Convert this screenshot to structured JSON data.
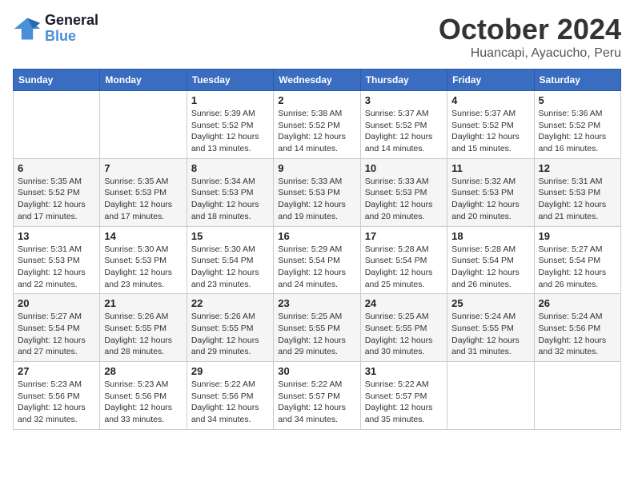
{
  "header": {
    "logo_line1": "General",
    "logo_line2": "Blue",
    "month_title": "October 2024",
    "location": "Huancapi, Ayacucho, Peru"
  },
  "days_of_week": [
    "Sunday",
    "Monday",
    "Tuesday",
    "Wednesday",
    "Thursday",
    "Friday",
    "Saturday"
  ],
  "weeks": [
    [
      {
        "num": "",
        "detail": ""
      },
      {
        "num": "",
        "detail": ""
      },
      {
        "num": "1",
        "detail": "Sunrise: 5:39 AM\nSunset: 5:52 PM\nDaylight: 12 hours and 13 minutes."
      },
      {
        "num": "2",
        "detail": "Sunrise: 5:38 AM\nSunset: 5:52 PM\nDaylight: 12 hours and 14 minutes."
      },
      {
        "num": "3",
        "detail": "Sunrise: 5:37 AM\nSunset: 5:52 PM\nDaylight: 12 hours and 14 minutes."
      },
      {
        "num": "4",
        "detail": "Sunrise: 5:37 AM\nSunset: 5:52 PM\nDaylight: 12 hours and 15 minutes."
      },
      {
        "num": "5",
        "detail": "Sunrise: 5:36 AM\nSunset: 5:52 PM\nDaylight: 12 hours and 16 minutes."
      }
    ],
    [
      {
        "num": "6",
        "detail": "Sunrise: 5:35 AM\nSunset: 5:52 PM\nDaylight: 12 hours and 17 minutes."
      },
      {
        "num": "7",
        "detail": "Sunrise: 5:35 AM\nSunset: 5:53 PM\nDaylight: 12 hours and 17 minutes."
      },
      {
        "num": "8",
        "detail": "Sunrise: 5:34 AM\nSunset: 5:53 PM\nDaylight: 12 hours and 18 minutes."
      },
      {
        "num": "9",
        "detail": "Sunrise: 5:33 AM\nSunset: 5:53 PM\nDaylight: 12 hours and 19 minutes."
      },
      {
        "num": "10",
        "detail": "Sunrise: 5:33 AM\nSunset: 5:53 PM\nDaylight: 12 hours and 20 minutes."
      },
      {
        "num": "11",
        "detail": "Sunrise: 5:32 AM\nSunset: 5:53 PM\nDaylight: 12 hours and 20 minutes."
      },
      {
        "num": "12",
        "detail": "Sunrise: 5:31 AM\nSunset: 5:53 PM\nDaylight: 12 hours and 21 minutes."
      }
    ],
    [
      {
        "num": "13",
        "detail": "Sunrise: 5:31 AM\nSunset: 5:53 PM\nDaylight: 12 hours and 22 minutes."
      },
      {
        "num": "14",
        "detail": "Sunrise: 5:30 AM\nSunset: 5:53 PM\nDaylight: 12 hours and 23 minutes."
      },
      {
        "num": "15",
        "detail": "Sunrise: 5:30 AM\nSunset: 5:54 PM\nDaylight: 12 hours and 23 minutes."
      },
      {
        "num": "16",
        "detail": "Sunrise: 5:29 AM\nSunset: 5:54 PM\nDaylight: 12 hours and 24 minutes."
      },
      {
        "num": "17",
        "detail": "Sunrise: 5:28 AM\nSunset: 5:54 PM\nDaylight: 12 hours and 25 minutes."
      },
      {
        "num": "18",
        "detail": "Sunrise: 5:28 AM\nSunset: 5:54 PM\nDaylight: 12 hours and 26 minutes."
      },
      {
        "num": "19",
        "detail": "Sunrise: 5:27 AM\nSunset: 5:54 PM\nDaylight: 12 hours and 26 minutes."
      }
    ],
    [
      {
        "num": "20",
        "detail": "Sunrise: 5:27 AM\nSunset: 5:54 PM\nDaylight: 12 hours and 27 minutes."
      },
      {
        "num": "21",
        "detail": "Sunrise: 5:26 AM\nSunset: 5:55 PM\nDaylight: 12 hours and 28 minutes."
      },
      {
        "num": "22",
        "detail": "Sunrise: 5:26 AM\nSunset: 5:55 PM\nDaylight: 12 hours and 29 minutes."
      },
      {
        "num": "23",
        "detail": "Sunrise: 5:25 AM\nSunset: 5:55 PM\nDaylight: 12 hours and 29 minutes."
      },
      {
        "num": "24",
        "detail": "Sunrise: 5:25 AM\nSunset: 5:55 PM\nDaylight: 12 hours and 30 minutes."
      },
      {
        "num": "25",
        "detail": "Sunrise: 5:24 AM\nSunset: 5:55 PM\nDaylight: 12 hours and 31 minutes."
      },
      {
        "num": "26",
        "detail": "Sunrise: 5:24 AM\nSunset: 5:56 PM\nDaylight: 12 hours and 32 minutes."
      }
    ],
    [
      {
        "num": "27",
        "detail": "Sunrise: 5:23 AM\nSunset: 5:56 PM\nDaylight: 12 hours and 32 minutes."
      },
      {
        "num": "28",
        "detail": "Sunrise: 5:23 AM\nSunset: 5:56 PM\nDaylight: 12 hours and 33 minutes."
      },
      {
        "num": "29",
        "detail": "Sunrise: 5:22 AM\nSunset: 5:56 PM\nDaylight: 12 hours and 34 minutes."
      },
      {
        "num": "30",
        "detail": "Sunrise: 5:22 AM\nSunset: 5:57 PM\nDaylight: 12 hours and 34 minutes."
      },
      {
        "num": "31",
        "detail": "Sunrise: 5:22 AM\nSunset: 5:57 PM\nDaylight: 12 hours and 35 minutes."
      },
      {
        "num": "",
        "detail": ""
      },
      {
        "num": "",
        "detail": ""
      }
    ]
  ]
}
